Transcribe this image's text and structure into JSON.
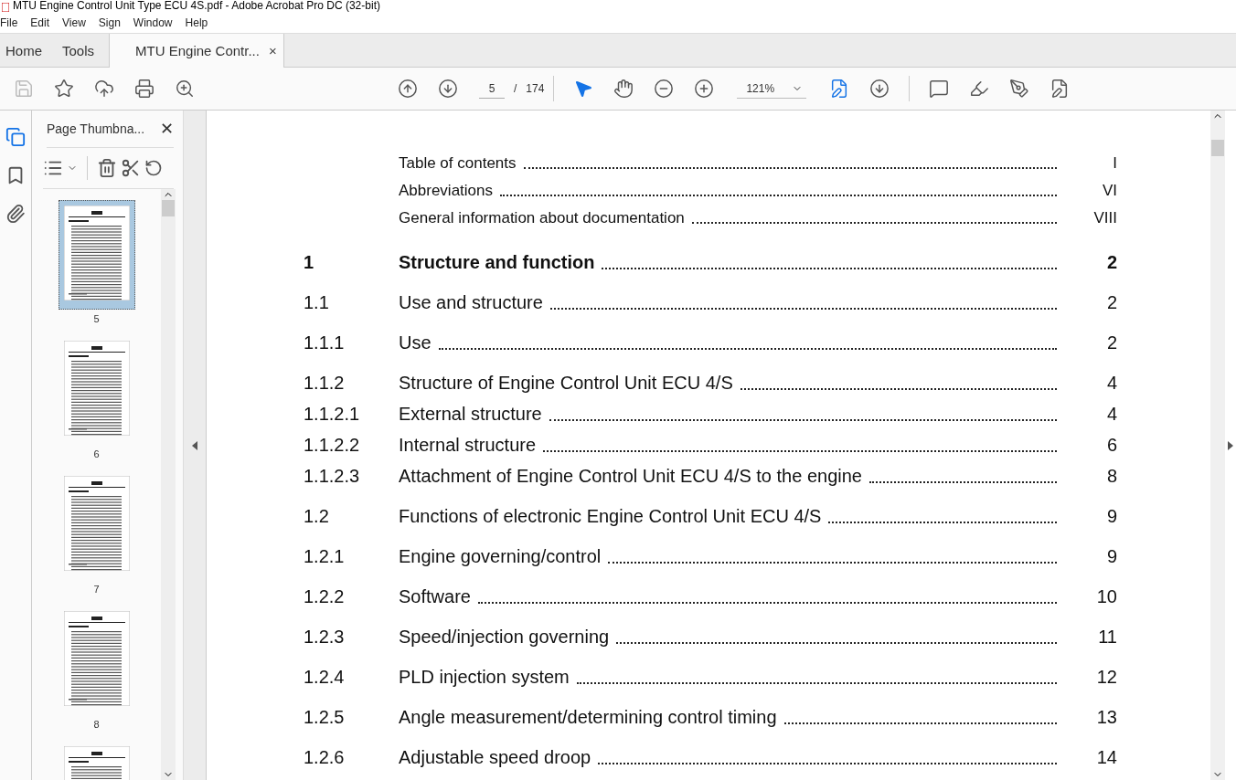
{
  "window": {
    "title": "MTU Engine Control Unit Type ECU 4S.pdf - Adobe Acrobat Pro DC (32-bit)"
  },
  "menu": [
    "File",
    "Edit",
    "View",
    "Sign",
    "Window",
    "Help"
  ],
  "tabs": [
    {
      "label": "Home",
      "selected": false
    },
    {
      "label": "Tools",
      "selected": false
    },
    {
      "label": "MTU Engine Contr...",
      "selected": true,
      "close": "×"
    }
  ],
  "toolbar": {
    "page": "5",
    "separator": "/",
    "total": "174",
    "zoom": "121%"
  },
  "sidebar": {
    "title": "Page Thumbna...",
    "close": "✕",
    "thumbnails": [
      {
        "label": "5",
        "selected": true
      },
      {
        "label": "6",
        "selected": false
      },
      {
        "label": "7",
        "selected": false
      },
      {
        "label": "8",
        "selected": false
      }
    ]
  },
  "toc": [
    {
      "kind": "front",
      "title": "Table of contents",
      "page": "I"
    },
    {
      "kind": "front",
      "title": "Abbreviations",
      "page": "VI"
    },
    {
      "kind": "front",
      "title": "General information about documentation",
      "page": "VIII"
    },
    {
      "kind": "chapter",
      "number": "1",
      "title": "Structure and function",
      "page": "2"
    },
    {
      "kind": "section",
      "number": "1.1",
      "title": "Use and structure",
      "page": "2"
    },
    {
      "kind": "section",
      "number": "1.1.1",
      "title": "Use",
      "page": "2"
    },
    {
      "kind": "section",
      "number": "1.1.2",
      "title": "Structure of Engine Control Unit ECU 4/S",
      "page": "4"
    },
    {
      "kind": "sub",
      "number": "1.1.2.1",
      "title": "External structure",
      "page": "4"
    },
    {
      "kind": "sub",
      "number": "1.1.2.2",
      "title": "Internal structure",
      "page": "6"
    },
    {
      "kind": "sub",
      "number": "1.1.2.3",
      "title": "Attachment of Engine Control Unit ECU 4/S to the engine",
      "page": "8"
    },
    {
      "kind": "section",
      "number": "1.2",
      "title": "Functions of electronic Engine Control Unit ECU 4/S",
      "page": "9"
    },
    {
      "kind": "section",
      "number": "1.2.1",
      "title": "Engine governing/control",
      "page": "9"
    },
    {
      "kind": "section",
      "number": "1.2.2",
      "title": "Software",
      "page": "10"
    },
    {
      "kind": "section",
      "number": "1.2.3",
      "title": "Speed/injection governing",
      "page": "11"
    },
    {
      "kind": "section",
      "number": "1.2.4",
      "title": "PLD injection system",
      "page": "12"
    },
    {
      "kind": "section",
      "number": "1.2.5",
      "title": "Angle measurement/determining control timing",
      "page": "13"
    },
    {
      "kind": "section",
      "number": "1.2.6",
      "title": "Adjustable speed droop",
      "page": "14"
    }
  ]
}
